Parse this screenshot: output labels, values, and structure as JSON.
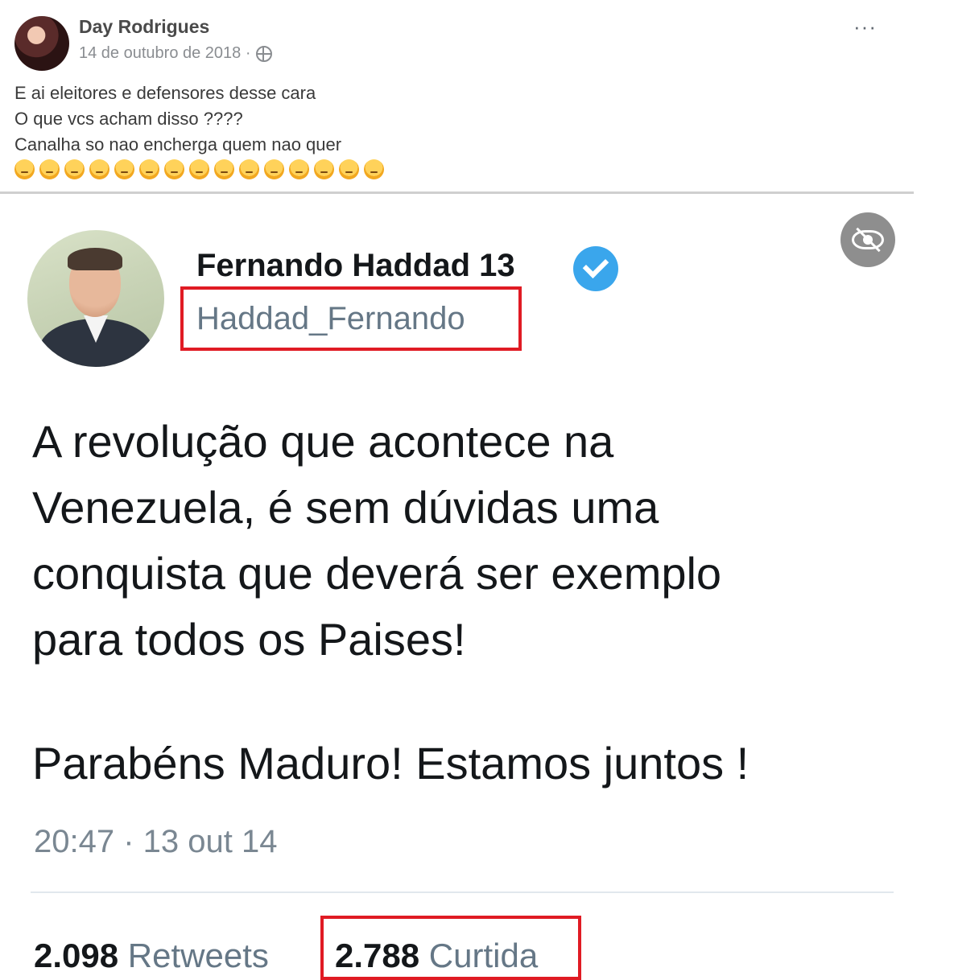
{
  "fb_post": {
    "author": "Day Rodrigues",
    "date": "14 de outubro de 2018 ·",
    "more": "···",
    "text_lines": [
      "E ai eleitores  e defensores desse cara",
      "O que vcs acham disso ????",
      "Canalha so nao encherga quem nao quer"
    ],
    "emoji_count": 15
  },
  "tweet": {
    "name": "Fernando Haddad 13",
    "handle": "Haddad_Fernando",
    "body_lines": [
      "A revolução que acontece na",
      "Venezuela, é sem dúvidas uma",
      "conquista que deverá ser exemplo",
      "para todos os Paises!"
    ],
    "body_closing": "Parabéns Maduro! Estamos juntos !",
    "time": "20:47 · 13 out 14",
    "retweets_count": "2.098",
    "retweets_label": "Retweets",
    "likes_count": "2.788",
    "likes_label": "Curtida"
  },
  "colors": {
    "highlight_box": "#e01b24",
    "verified": "#3aa6ec"
  }
}
